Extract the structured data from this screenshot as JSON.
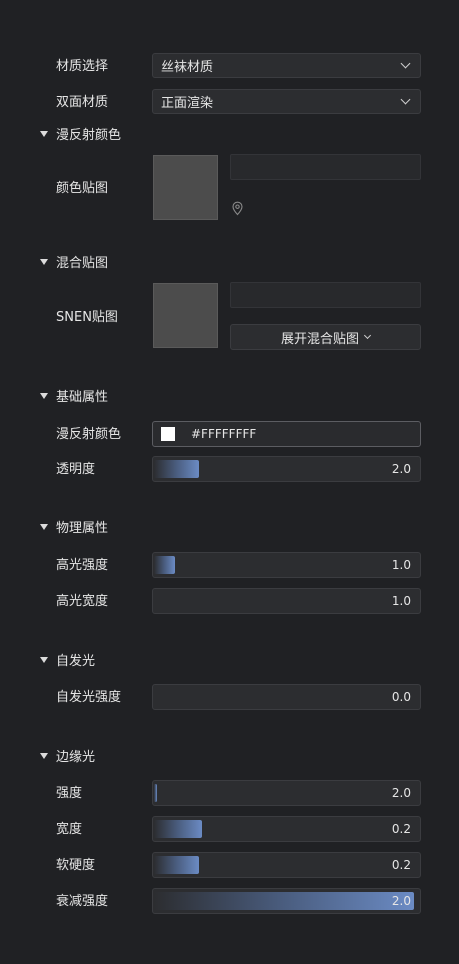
{
  "material_select": {
    "label": "材质选择",
    "value": "丝袜材质"
  },
  "double_side": {
    "label": "双面材质",
    "value": "正面渲染"
  },
  "diffuse_color_section": {
    "title": "漫反射颜色",
    "texture_label": "颜色贴图"
  },
  "blend_section": {
    "title": "混合贴图",
    "texture_label": "SNEN贴图",
    "expand_button": "展开混合贴图"
  },
  "basic_section": {
    "title": "基础属性",
    "diffuse_label": "漫反射颜色",
    "diffuse_value": "#FFFFFFFF",
    "opacity": {
      "label": "透明度",
      "value": "2.0",
      "fill": 0.17
    }
  },
  "physical_section": {
    "title": "物理属性",
    "specular_strength": {
      "label": "高光强度",
      "value": "1.0",
      "fill": 0.08
    },
    "specular_width": {
      "label": "高光宽度",
      "value": "1.0",
      "fill": 0
    }
  },
  "emissive_section": {
    "title": "自发光",
    "emissive_strength": {
      "label": "自发光强度",
      "value": "0.0",
      "fill": 0
    }
  },
  "rim_section": {
    "title": "边缘光",
    "strength": {
      "label": "强度",
      "value": "2.0",
      "fill": 0.01
    },
    "width": {
      "label": "宽度",
      "value": "0.2",
      "fill": 0.18
    },
    "softness": {
      "label": "软硬度",
      "value": "0.2",
      "fill": 0.17
    },
    "falloff": {
      "label": "衰减强度",
      "value": "2.0",
      "fill": 0.98
    }
  }
}
